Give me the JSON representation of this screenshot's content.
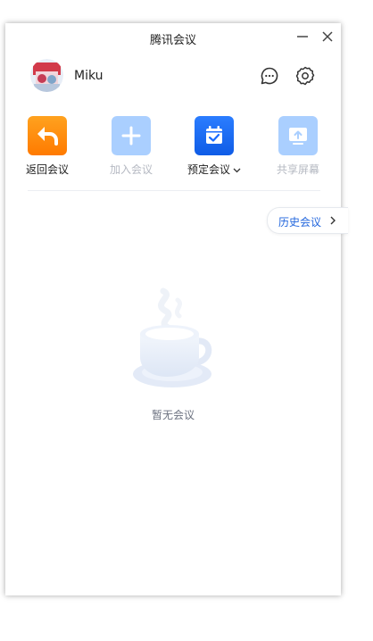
{
  "window": {
    "title": "腾讯会议"
  },
  "user": {
    "name": "Miku"
  },
  "actions": [
    {
      "label": "返回会议",
      "enabled": true,
      "icon": "back-arrow-icon",
      "color": "#ff8a00"
    },
    {
      "label": "加入会议",
      "enabled": false,
      "icon": "plus-icon",
      "color": "#aacfff"
    },
    {
      "label": "预定会议",
      "enabled": true,
      "icon": "calendar-check-icon",
      "color": "#1a6cff",
      "has_dropdown": true
    },
    {
      "label": "共享屏幕",
      "enabled": false,
      "icon": "share-screen-icon",
      "color": "#aacfff"
    }
  ],
  "history": {
    "label": "历史会议"
  },
  "empty_state": {
    "text": "暂无会议"
  },
  "colors": {
    "accent": "#1a6cff",
    "link": "#2266dd",
    "muted": "#b5b9c2"
  }
}
